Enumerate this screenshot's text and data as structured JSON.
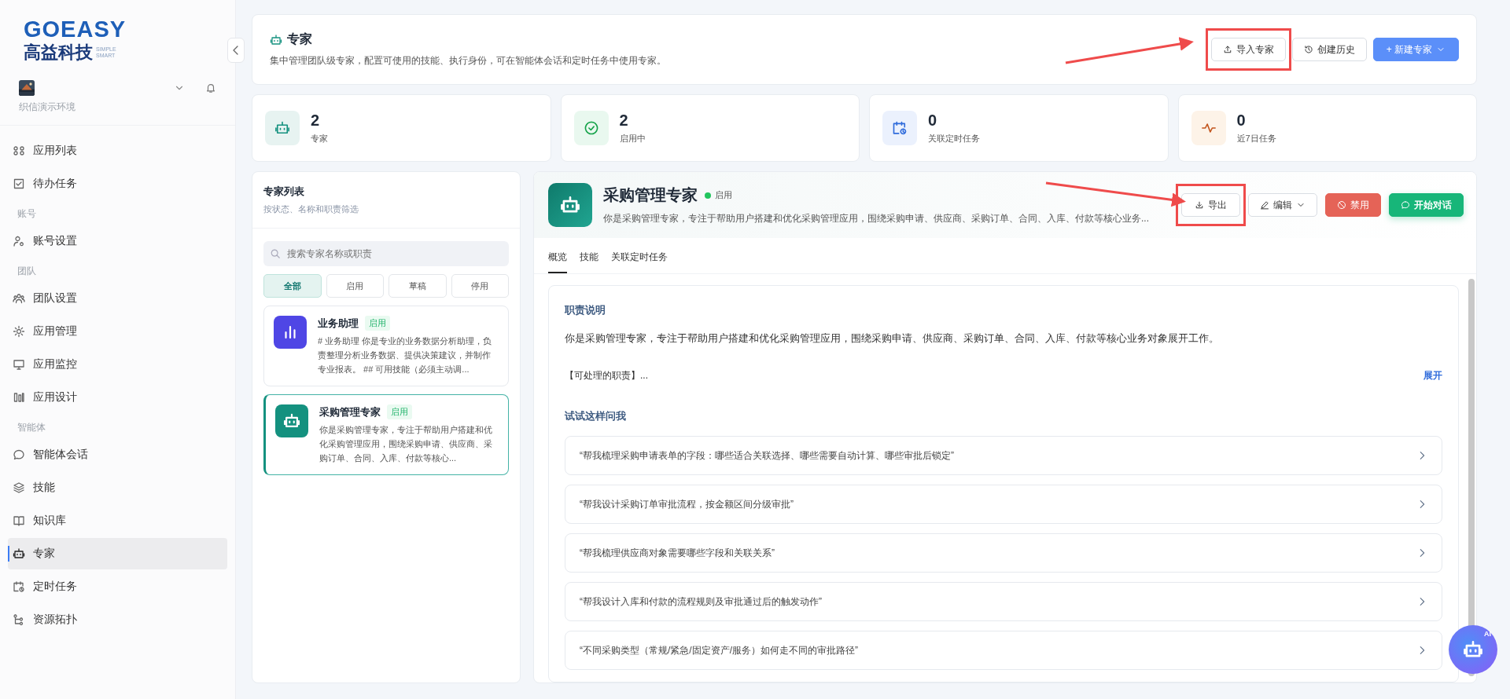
{
  "sidebar": {
    "logo": {
      "wordmark": "GOEASY",
      "name": "高益科技",
      "tagline": [
        "SIMPLE",
        "SMART"
      ]
    },
    "org": "织信演示环境",
    "groups": [
      {
        "items": [
          {
            "label": "应用列表",
            "selected": false
          },
          {
            "label": "待办任务",
            "selected": false
          }
        ]
      },
      {
        "title": "账号",
        "items": [
          {
            "label": "账号设置",
            "selected": false
          }
        ]
      },
      {
        "title": "团队",
        "items": [
          {
            "label": "团队设置",
            "selected": false
          },
          {
            "label": "应用管理",
            "selected": false
          },
          {
            "label": "应用监控",
            "selected": false
          },
          {
            "label": "应用设计",
            "selected": false
          }
        ]
      },
      {
        "title": "智能体",
        "items": [
          {
            "label": "智能体会话",
            "selected": false
          },
          {
            "label": "技能",
            "selected": false
          },
          {
            "label": "知识库",
            "selected": false
          },
          {
            "label": "专家",
            "selected": true
          },
          {
            "label": "定时任务",
            "selected": false
          },
          {
            "label": "资源拓扑",
            "selected": false
          }
        ]
      }
    ]
  },
  "header": {
    "title": "专家",
    "subtitle": "集中管理团队级专家，配置可使用的技能、执行身份，可在智能体会话和定时任务中使用专家。",
    "buttons": [
      "导入专家",
      "创建历史",
      "+ 新建专家"
    ]
  },
  "stats": [
    {
      "value": "2",
      "label": "专家"
    },
    {
      "value": "2",
      "label": "启用中"
    },
    {
      "value": "0",
      "label": "关联定时任务"
    },
    {
      "value": "0",
      "label": "近7日任务"
    }
  ],
  "expert_list": {
    "title": "专家列表",
    "subtitle": "按状态、名称和职责筛选",
    "search": {
      "placeholder": "搜索专家名称或职责"
    },
    "filters": [
      {
        "label": "全部",
        "selected": true
      },
      {
        "label": "启用",
        "selected": false
      },
      {
        "label": "草稿",
        "selected": false
      },
      {
        "label": "停用",
        "selected": false
      }
    ],
    "items": [
      {
        "name": "业务助理",
        "status": "启用",
        "color": "#4f46e5",
        "description": "# 业务助理 你是专业的业务数据分析助理，负责整理分析业务数据、提供决策建议，并制作专业报表。 ## 可用技能（必须主动调...",
        "selected": false
      },
      {
        "name": "采购管理专家",
        "status": "启用",
        "color": "#14917f",
        "description": "你是采购管理专家，专注于帮助用户搭建和优化采购管理应用，围绕采购申请、供应商、采购订单、合同、入库、付款等核心...",
        "selected": true
      }
    ]
  },
  "detail": {
    "name": "采购管理专家",
    "status": "启用",
    "description": "你是采购管理专家，专注于帮助用户搭建和优化采购管理应用，围绕采购申请、供应商、采购订单、合同、入库、付款等核心业务...",
    "actions": [
      "导出",
      "编辑",
      "禁用",
      "开始对话"
    ],
    "tabs": [
      {
        "label": "概览",
        "selected": true
      },
      {
        "label": "技能",
        "selected": false
      },
      {
        "label": "关联定时任务",
        "selected": false
      }
    ],
    "duty_title": "职责说明",
    "duty_text": "你是采购管理专家，专注于帮助用户搭建和优化采购管理应用，围绕采购申请、供应商、采购订单、合同、入库、付款等核心业务对象展开工作。",
    "duty_more": "【可处理的职责】...",
    "expand": "展开",
    "prompts_title": "试试这样问我",
    "prompts": [
      "“帮我梳理采购申请表单的字段：哪些适合关联选择、哪些需要自动计算、哪些审批后锁定”",
      "“帮我设计采购订单审批流程，按金额区间分级审批”",
      "“帮我梳理供应商对象需要哪些字段和关联关系”",
      "“帮我设计入库和付款的流程规则及审批通过后的触发动作”",
      "“不同采购类型（常规/紧急/固定资产/服务）如何走不同的审批路径”"
    ]
  },
  "assistant": {
    "badge": "AI"
  }
}
